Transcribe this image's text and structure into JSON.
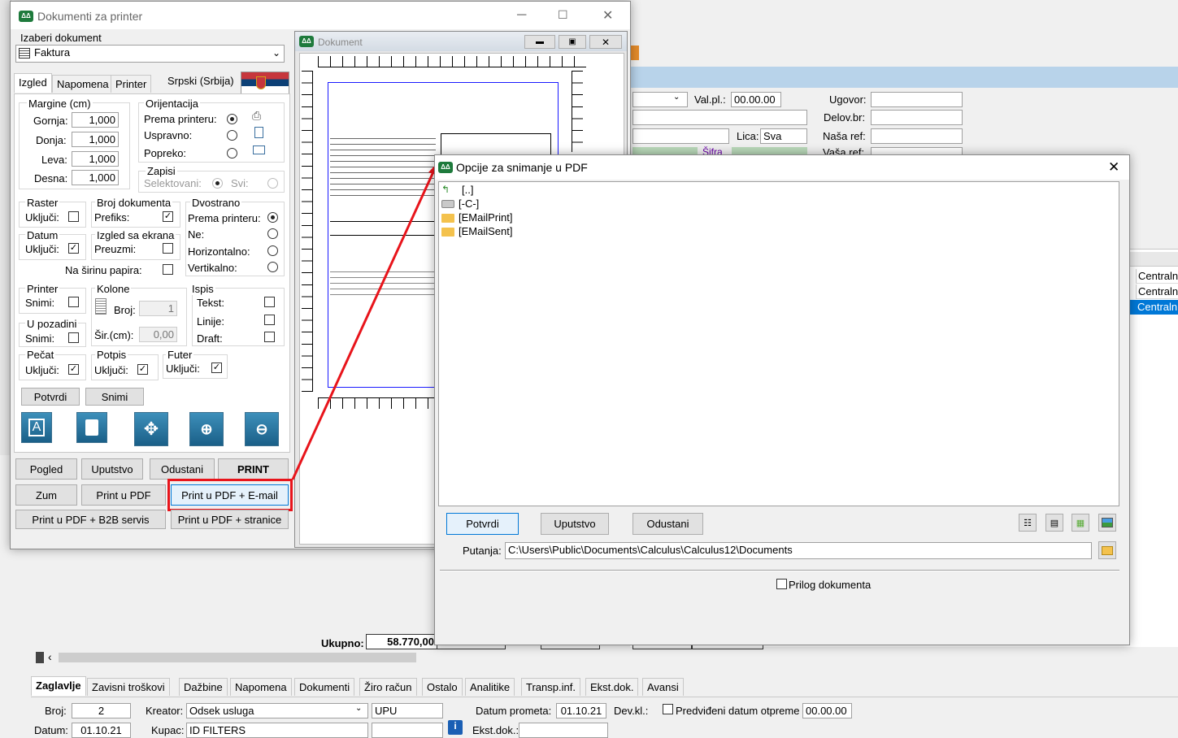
{
  "main": {
    "valpl_label": "Val.pl.:",
    "valpl_value": "00.00.00",
    "lica_label": "Lica:",
    "lica_value": "Sva",
    "ugovor_label": "Ugovor:",
    "delov_label": "Delov.br:",
    "nasa_ref_label": "Naša ref:",
    "vasa_ref_label": "Vaša ref:",
    "sifra_label": "Šifra",
    "grid_cells": [
      "Centraln",
      "Centraln",
      "Centraln"
    ],
    "ukupno_label": "Ukupno:",
    "ukupno_value": "58.770,00",
    "scroll_left": "‹",
    "bottom_tabs": [
      "Zaglavlje",
      "Zavisni troškovi",
      "Dažbine",
      "Napomena",
      "Dokumenti",
      "Žiro račun",
      "Ostalo",
      "Analitike",
      "Transp.inf.",
      "Ekst.dok.",
      "Avansi"
    ],
    "broj_label": "Broj:",
    "broj_value": "2",
    "kreator_label": "Kreator:",
    "kreator_value": "Odsek usluga",
    "upu_value": "UPU",
    "datum_prometa_label": "Datum prometa:",
    "datum_prometa_value": "01.10.21",
    "devkl_label": "Dev.kl.:",
    "predvidjeni_label": "Predviđeni datum otpreme",
    "predvidjeni_value": "00.00.00",
    "datum_label": "Datum:",
    "datum_value": "01.10.21",
    "kupac_label": "Kupac:",
    "kupac_value": "ID FILTERS",
    "ekst_label": "Ekst.dok.:"
  },
  "printer": {
    "title": "Dokumenti za printer",
    "izaberi_label": "Izaberi dokument",
    "doc_value": "Faktura",
    "tabs": [
      "Izgled",
      "Napomena",
      "Printer"
    ],
    "language": "Srpski (Srbija)",
    "margine_title": "Margine (cm)",
    "gornja_label": "Gornja:",
    "gornja_value": "1,000",
    "donja_label": "Donja:",
    "donja_value": "1,000",
    "leva_label": "Leva:",
    "leva_value": "1,000",
    "desna_label": "Desna:",
    "desna_value": "1,000",
    "orijentacija_title": "Orijentacija",
    "prema_printeru": "Prema printeru:",
    "uspravno": "Uspravno:",
    "popreko": "Popreko:",
    "zapisi_title": "Zapisi",
    "selektovani": "Selektovani:",
    "svi": "Svi:",
    "raster_title": "Raster",
    "ukljuci": "Uključi:",
    "broj_dok_title": "Broj dokumenta",
    "prefiks": "Prefiks:",
    "dvostrano_title": "Dvostrano",
    "ne": "Ne:",
    "horizontalno": "Horizontalno:",
    "vertikalno": "Vertikalno:",
    "datum_title": "Datum",
    "izgled_ekrana_title": "Izgled sa ekrana",
    "preuzmi": "Preuzmi:",
    "na_sirinu": "Na širinu papira:",
    "printer_title": "Printer",
    "snimi": "Snimi:",
    "kolone_title": "Kolone",
    "broj": "Broj:",
    "broj_value": "1",
    "sir": "Šir.(cm):",
    "sir_value": "0,00",
    "ispis_title": "Ispis",
    "tekst": "Tekst:",
    "linije": "Linije:",
    "draft": "Draft:",
    "u_pozadini_title": "U pozadini",
    "pecat_title": "Pečat",
    "potpis_title": "Potpis",
    "futer_title": "Futer",
    "potvrdi": "Potvrdi",
    "snimi_btn": "Snimi",
    "pogled": "Pogled",
    "uputstvo": "Uputstvo",
    "odustani": "Odustani",
    "print": "PRINT",
    "zum": "Zum",
    "print_pdf": "Print u PDF",
    "print_pdf_email": "Print u PDF + E-mail",
    "print_pdf_b2b": "Print u PDF + B2B servis",
    "print_pdf_stranice": "Print u PDF + stranice"
  },
  "preview": {
    "title": "Dokument"
  },
  "pdf": {
    "title": "Opcije za snimanje u PDF",
    "items": [
      "[..]",
      "[-C-]",
      "[EMailPrint]",
      "[EMailSent]"
    ],
    "potvrdi": "Potvrdi",
    "uputstvo": "Uputstvo",
    "odustani": "Odustani",
    "putanja_label": "Putanja:",
    "putanja_value": "C:\\Users\\Public\\Documents\\Calculus\\Calculus12\\Documents",
    "prilog_label": "Prilog dokumenta"
  },
  "colors": {
    "highlight": "#e8141b",
    "selection": "#0078d7",
    "logo": "#1e7a3c"
  }
}
